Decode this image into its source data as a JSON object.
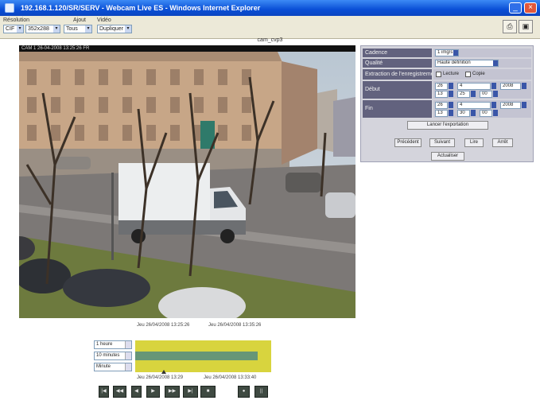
{
  "window": {
    "title": "192.168.1.120/SR/SERV - Webcam Live ES - Windows Internet Explorer"
  },
  "toolbar": {
    "labels": [
      "Résolution",
      "Ajout",
      "Vidéo"
    ],
    "selects": [
      "CIF",
      "352x288",
      "Tous",
      "Dupliquer"
    ]
  },
  "camera": {
    "name": "cam_cvp3",
    "osd": "CAM 1  26-04-2008  13:25:26  FR"
  },
  "settings": {
    "rows": [
      {
        "label": "Cadence",
        "value": "1 img/s"
      },
      {
        "label": "Qualité",
        "value": "Haute définition"
      },
      {
        "label": "Extraction de l'enregistrement",
        "option_a": "Lecture",
        "option_b": "Copie"
      },
      {
        "label": "Début",
        "values": [
          "26",
          "4",
          "2008",
          "13",
          "25",
          "00"
        ]
      },
      {
        "label": "Fin",
        "values": [
          "26",
          "4",
          "2008",
          "13",
          "30",
          "00"
        ]
      }
    ],
    "export_button": "Lancer l'exportation",
    "buttons": [
      "Précédent",
      "Suivant",
      "Lire",
      "Arrêt"
    ],
    "refresh_button": "Actualiser"
  },
  "timeline": {
    "top_left": "Jeu 26/04/2008 13:25:26",
    "top_right": "Jeu 26/04/2008 13:35:26",
    "bottom_left": "Jeu 26/04/2008 13:29",
    "bottom_right": "Jeu 26/04/2008 13:33:40",
    "selects": [
      "1 heure",
      "10 minutes",
      "Minute"
    ],
    "progress": 0.9
  },
  "playback": {
    "buttons": [
      "|◀",
      "◀◀",
      "◀",
      "▶",
      "▶▶",
      "▶|",
      "■",
      "●",
      "||"
    ]
  }
}
